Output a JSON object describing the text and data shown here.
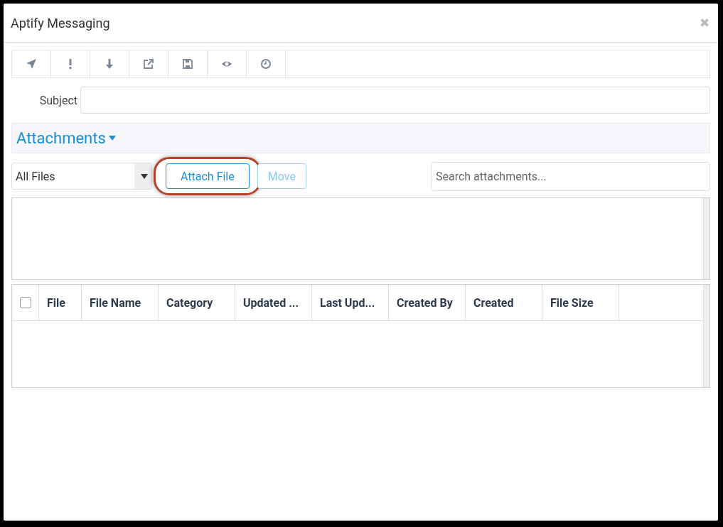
{
  "window": {
    "title": "Aptify Messaging",
    "close": "✖"
  },
  "subject": {
    "label": "Subject"
  },
  "attachments": {
    "title": "Attachments",
    "filter": "All Files",
    "buttons": [
      {
        "label": "Attach File",
        "disabled": false,
        "highlighted": true
      },
      {
        "label": "Move",
        "disabled": true,
        "highlighted": false
      }
    ],
    "search": {
      "placeholder": "Search attachments..."
    },
    "grid": {
      "select_all": {
        "checked": false
      },
      "columns": [
        "File",
        "File Name",
        "Category",
        "Updated ...",
        "Last Upd...",
        "Created By",
        "Created",
        "File Size"
      ]
    }
  }
}
